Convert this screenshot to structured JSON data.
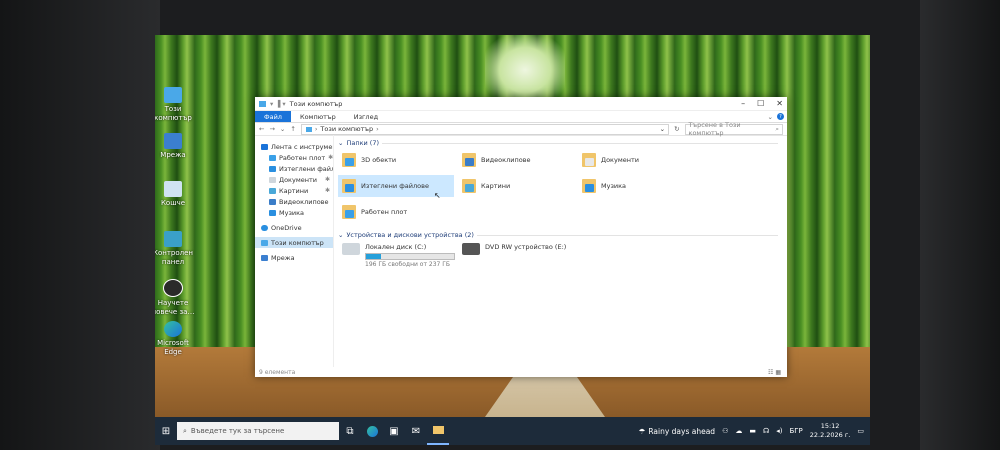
{
  "desktop": {
    "icons": [
      {
        "label": "Този компютър",
        "icon": "this-pc-icon"
      },
      {
        "label": "Мрежа",
        "icon": "network-icon"
      },
      {
        "label": "Кошче",
        "icon": "recycle-bin-icon"
      },
      {
        "label": "Контролен панел",
        "icon": "control-panel-icon"
      },
      {
        "label": "Научете повече за…",
        "icon": "learn-more-icon"
      },
      {
        "label": "Microsoft Edge",
        "icon": "edge-icon"
      }
    ]
  },
  "explorer": {
    "title": "Този компютър",
    "ribbon_tabs": [
      "Файл",
      "Компютър",
      "Изглед"
    ],
    "address": "Този компютър",
    "search_placeholder": "Търсене в Този компютър",
    "nav": [
      {
        "label": "Лента с инструменти",
        "pinned": false,
        "sub": false
      },
      {
        "label": "Работен плот",
        "pinned": true,
        "sub": true
      },
      {
        "label": "Изтеглени файлове",
        "pinned": true,
        "sub": true
      },
      {
        "label": "Документи",
        "pinned": true,
        "sub": true
      },
      {
        "label": "Картини",
        "pinned": true,
        "sub": true
      },
      {
        "label": "Видеоклипове",
        "pinned": false,
        "sub": true
      },
      {
        "label": "Музика",
        "pinned": false,
        "sub": true
      },
      {
        "label": "OneDrive",
        "pinned": false,
        "sub": false
      },
      {
        "label": "Този компютър",
        "pinned": false,
        "sub": false,
        "selected": true
      },
      {
        "label": "Мрежа",
        "pinned": false,
        "sub": false
      }
    ],
    "folders_header": "Папки (7)",
    "folders": [
      {
        "label": "3D обекти",
        "color": "#3aa0e8"
      },
      {
        "label": "Видеоклипове",
        "color": "#3a7dc8"
      },
      {
        "label": "Документи",
        "color": "#d8d8d8"
      },
      {
        "label": "Изтеглени файлове",
        "color": "#2a8fe0",
        "selected": true
      },
      {
        "label": "Картини",
        "color": "#4aa8d8"
      },
      {
        "label": "Музика",
        "color": "#2a8fe0"
      },
      {
        "label": "Работен плот",
        "color": "#3aa0e8"
      }
    ],
    "drives_header": "Устройства и дискови устройства (2)",
    "drives": [
      {
        "label": "Локален диск (C:)",
        "free_text": "196 ГБ свободни от 237 ГБ",
        "used_fraction": 0.17
      },
      {
        "label": "DVD RW устройство (E:)"
      }
    ],
    "status": "9 елемента"
  },
  "taskbar": {
    "search_placeholder": "Въведете тук за търсене",
    "weather": "Rainy days ahead",
    "language": "БГР",
    "time": "15:12",
    "date": "22.2.2026 г."
  }
}
